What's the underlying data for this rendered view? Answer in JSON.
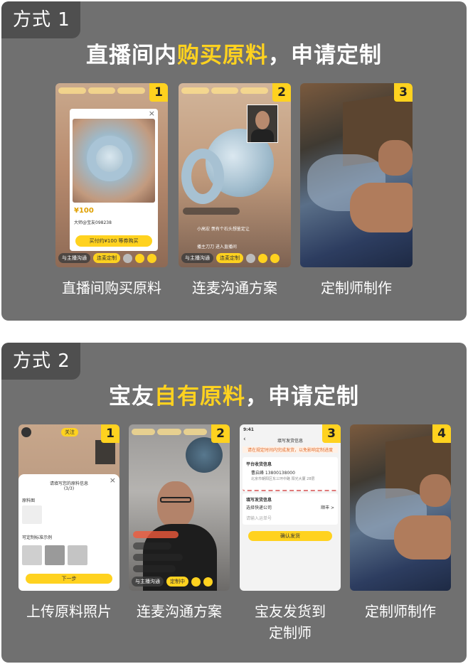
{
  "method1": {
    "tag": "方式 1",
    "headline": {
      "pre": "直播间内",
      "highlight": "购买原料",
      "post": "，申请定制"
    },
    "steps": [
      {
        "badge": "1",
        "caption": "直播间购买原料"
      },
      {
        "badge": "2",
        "caption": "连麦沟通方案"
      },
      {
        "badge": "3",
        "caption": "定制师制作"
      }
    ],
    "screen1": {
      "price": "¥100",
      "seller": "大师@宝友098238",
      "buy_button": "买付约¥100 等券购买",
      "talk_button": "与主播沟通",
      "custom_button": "连麦定制"
    },
    "screen2": {
      "chat_line": "小高宏 羡有个石头想鉴定让",
      "join_line": "播主刀刀 进入直播间",
      "talk_button": "与主播沟通",
      "custom_button": "连麦定制"
    }
  },
  "method2": {
    "tag": "方式 2",
    "headline": {
      "pre": "宝友",
      "highlight": "自有原料",
      "post": "，申请定制"
    },
    "steps": [
      {
        "badge": "1",
        "caption": "上传原料照片"
      },
      {
        "badge": "2",
        "caption": "连麦沟通方案"
      },
      {
        "badge": "3",
        "caption": "宝友发货到\n定制师"
      },
      {
        "badge": "4",
        "caption": "定制师制作"
      }
    ],
    "screen1": {
      "modal_title": "请填写您的原料信息",
      "modal_step": "(3/3)",
      "photo_label": "原料图",
      "example_label": "可定制标准示例",
      "next_button": "下一步",
      "follow_button": "关注"
    },
    "screen2": {
      "talk_button": "与主播沟通",
      "custom_button": "定制中"
    },
    "screen3": {
      "time": "9:41",
      "title": "填写发货信息",
      "notice": "请在规定时间内完成发货，以免影响定制进度",
      "platform_section": "平台收货信息",
      "receiver": "曹启峰 13800138000",
      "address": "北京市朝阳区东三环中路 阳光大厦 28层",
      "sender_section": "填写发货信息",
      "courier_label": "选择快递公司",
      "courier_value": "顺丰 >",
      "tracking_placeholder": "请输入运单号",
      "confirm_button": "确认发货"
    }
  },
  "colors": {
    "panel": "#707070",
    "tag": "#4f4f4f",
    "accent": "#ffd21f"
  }
}
